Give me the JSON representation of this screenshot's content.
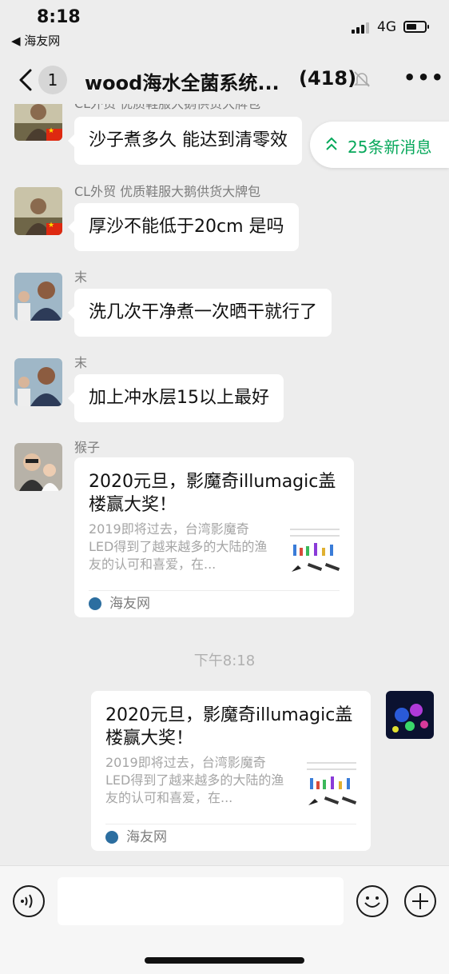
{
  "status_bar": {
    "time": "8:18",
    "back_app": "◀ 海友网",
    "network": "4G"
  },
  "nav": {
    "unread_count": "1",
    "title": "wood海水全菌系统...",
    "member_count": "(418)"
  },
  "new_messages_pill": "25条新消息",
  "messages": [
    {
      "sender": "CL外贸 优质鞋服大鹅供货大牌包",
      "text": "沙子煮多久 能达到清零效"
    },
    {
      "sender": "CL外贸 优质鞋服大鹅供货大牌包",
      "text": "厚沙不能低于20cm 是吗"
    },
    {
      "sender": "末",
      "text": "洗几次干净煮一次晒干就行了"
    },
    {
      "sender": "末",
      "text": "加上冲水层15以上最好"
    }
  ],
  "card_incoming": {
    "sender": "猴子",
    "title": "2020元旦，影魔奇illumagic盖楼赢大奖！",
    "description": "2019即将过去，台湾影魔奇LED得到了越来越多的大陆的渔友的认可和喜爱，在...",
    "source": "海友网"
  },
  "timestamp": "下午8:18",
  "card_outgoing": {
    "title": "2020元旦，影魔奇illumagic盖楼赢大奖！",
    "description": "2019即将过去，台湾影魔奇LED得到了越来越多的大陆的渔友的认可和喜爱，在...",
    "source": "海友网"
  },
  "input": {
    "placeholder": ""
  },
  "colors": {
    "accent_green": "#07a85b",
    "background": "#ededed",
    "bubble": "#ffffff"
  }
}
